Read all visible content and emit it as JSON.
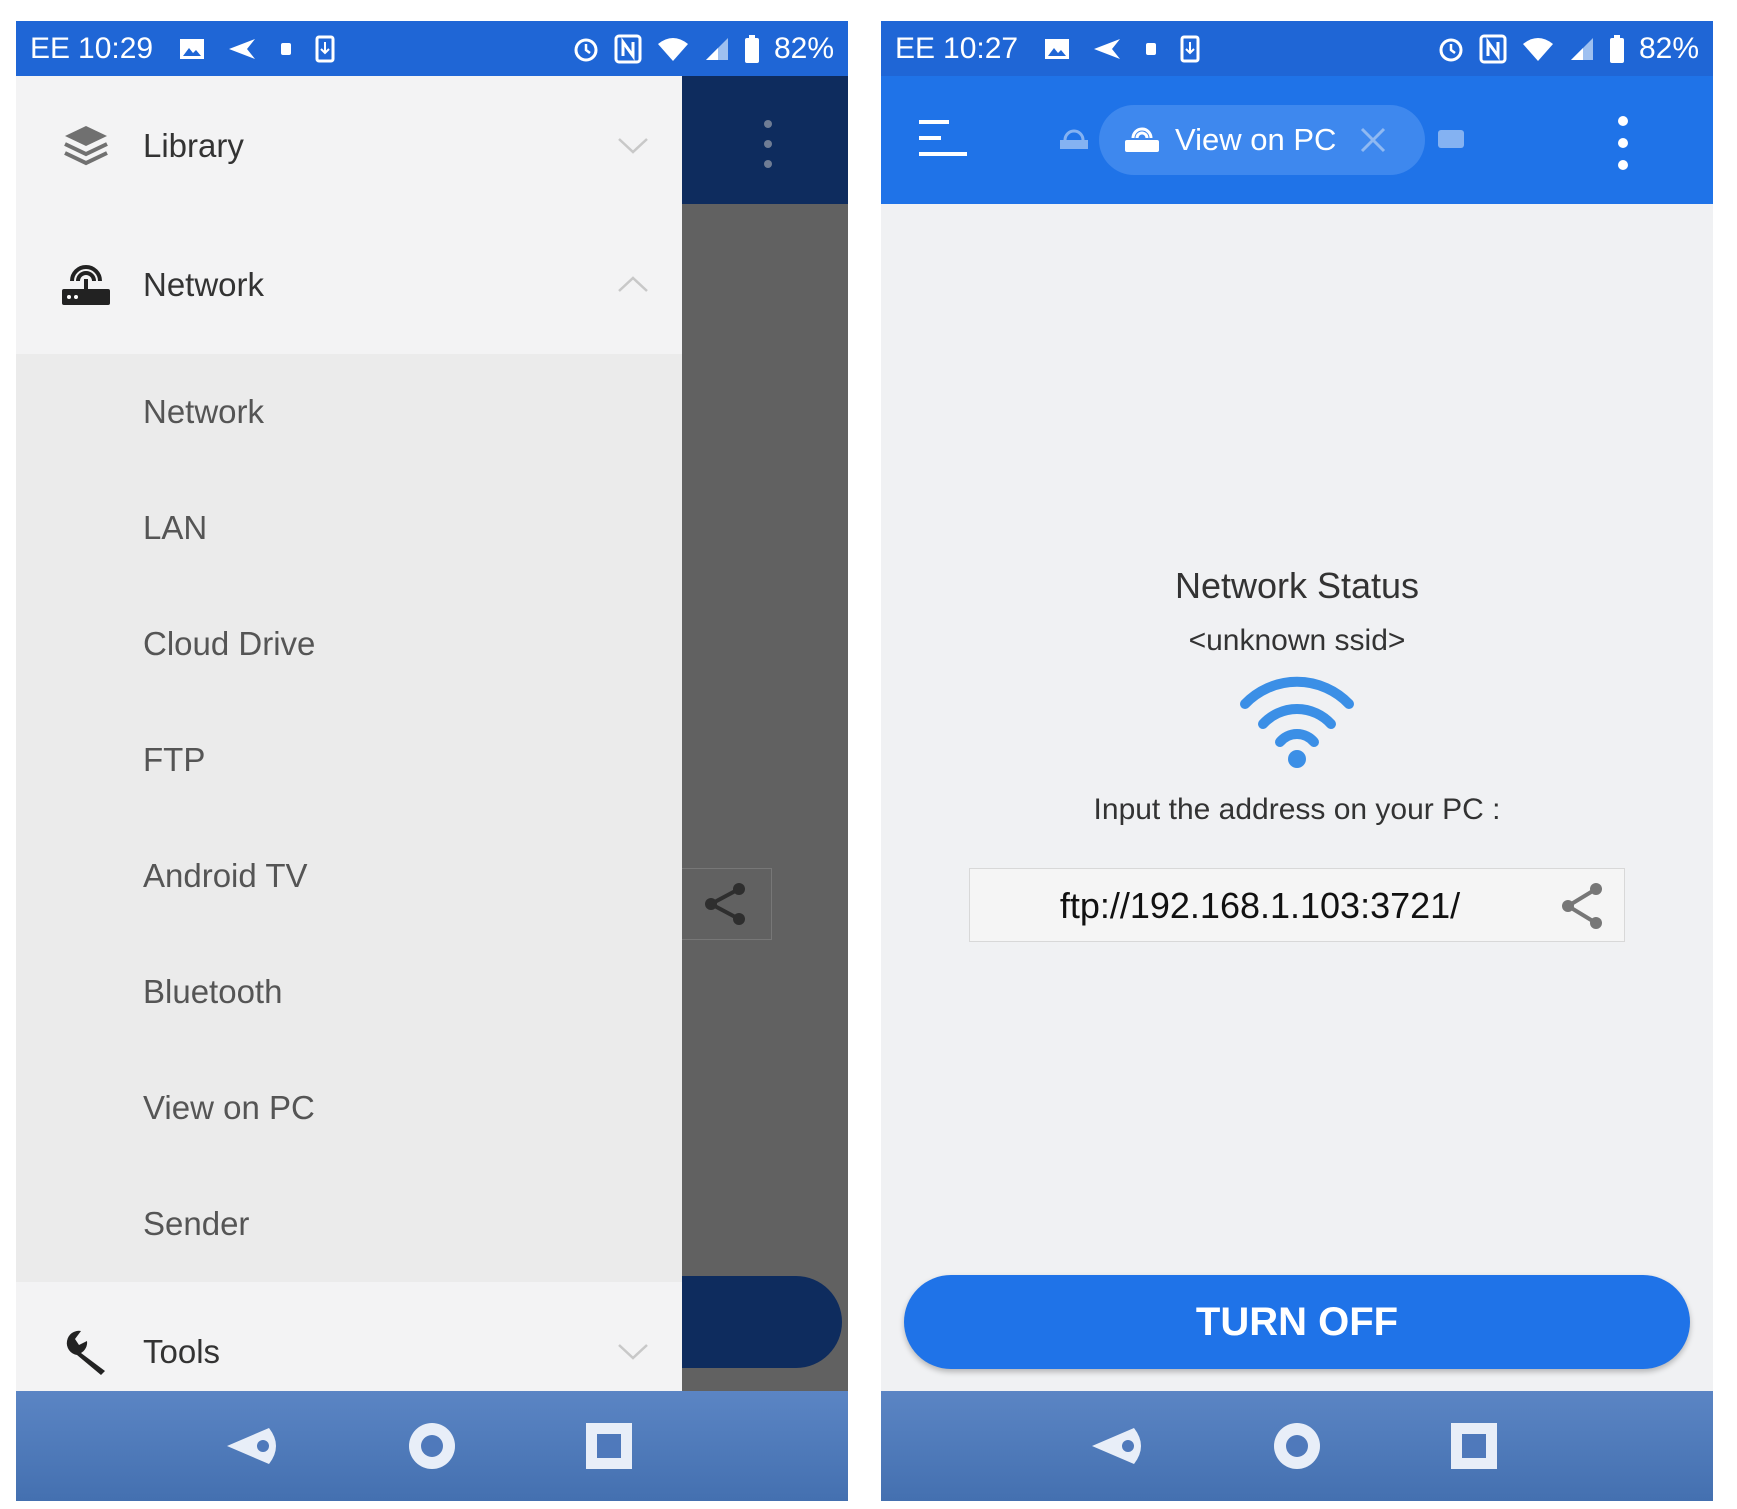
{
  "left_screen": {
    "status_bar": {
      "carrier": "EE",
      "time": "10:29",
      "battery": "82%"
    },
    "drawer": {
      "groups": [
        {
          "label": "Library",
          "icon": "stack-layers-icon",
          "expanded": false
        },
        {
          "label": "Network",
          "icon": "router-icon",
          "expanded": true
        },
        {
          "label": "Tools",
          "icon": "wrench-icon",
          "expanded": false
        }
      ],
      "network_items": [
        "Network",
        "LAN",
        "Cloud Drive",
        "FTP",
        "Android TV",
        "Bluetooth",
        "View on PC",
        "Sender"
      ]
    }
  },
  "right_screen": {
    "status_bar": {
      "carrier": "EE",
      "time": "10:27",
      "battery": "82%"
    },
    "tab": {
      "label": "View on PC",
      "icon": "router-icon"
    },
    "network_status": {
      "title": "Network Status",
      "ssid": "<unknown ssid>",
      "instruction": "Input the address on your PC :",
      "address": "ftp://192.168.1.103:3721/"
    },
    "turn_off_label": "TURN OFF"
  },
  "colors": {
    "primary": "#1f73e8",
    "status_bar": "#1f66d6",
    "dark_appbar": "#0e2c5e",
    "wifi_icon": "#3b8fe6"
  }
}
